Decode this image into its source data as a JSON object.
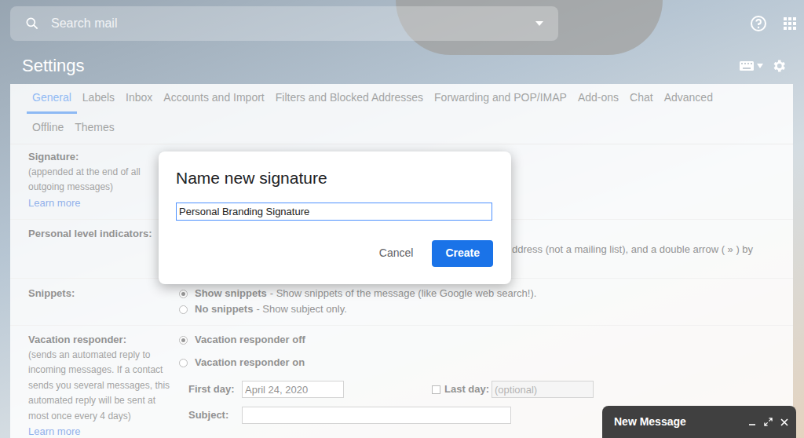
{
  "search": {
    "placeholder": "Search mail"
  },
  "page_title": "Settings",
  "tab_rows": [
    [
      {
        "label": "General",
        "selected": true
      },
      {
        "label": "Labels",
        "selected": false
      },
      {
        "label": "Inbox",
        "selected": false
      },
      {
        "label": "Accounts and Import",
        "selected": false
      },
      {
        "label": "Filters and Blocked Addresses",
        "selected": false
      },
      {
        "label": "Forwarding and POP/IMAP",
        "selected": false
      },
      {
        "label": "Add-ons",
        "selected": false
      },
      {
        "label": "Chat",
        "selected": false
      },
      {
        "label": "Advanced",
        "selected": false
      }
    ],
    [
      {
        "label": "Offline",
        "selected": false
      },
      {
        "label": "Themes",
        "selected": false
      }
    ]
  ],
  "signature": {
    "label": "Signature:",
    "description": "(appended at the end of all outgoing messages)",
    "link": "Learn more"
  },
  "personal_level_indicators": {
    "label": "Personal level indicators:",
    "text": "ddress (not a mailing list), and a double arrow ( » ) by"
  },
  "snippets": {
    "label": "Snippets:",
    "options": [
      {
        "title": "Show snippets",
        "description": "- Show snippets of the message (like Google web search!).",
        "selected": true
      },
      {
        "title": "No snippets",
        "description": "- Show subject only.",
        "selected": false
      }
    ]
  },
  "vacation_responder": {
    "label": "Vacation responder:",
    "description": "(sends an automated reply to incoming messages. If a contact sends you several messages, this automated reply will be sent at most once every 4 days)",
    "link": "Learn more",
    "options": [
      {
        "title": "Vacation responder off",
        "selected": true
      },
      {
        "title": "Vacation responder on",
        "selected": false
      }
    ],
    "first_day": {
      "label": "First day:",
      "value": "April 24, 2020"
    },
    "last_day": {
      "label": "Last day:",
      "checked": false,
      "placeholder": "(optional)",
      "disabled": true
    },
    "subject": {
      "label": "Subject:",
      "value": ""
    }
  },
  "dialog": {
    "title": "Name new signature",
    "input_value": "Personal Branding Signature",
    "buttons": [
      {
        "label": "Cancel",
        "primary": false
      },
      {
        "label": "Create",
        "primary": true
      }
    ]
  },
  "compose": {
    "title": "New Message"
  }
}
